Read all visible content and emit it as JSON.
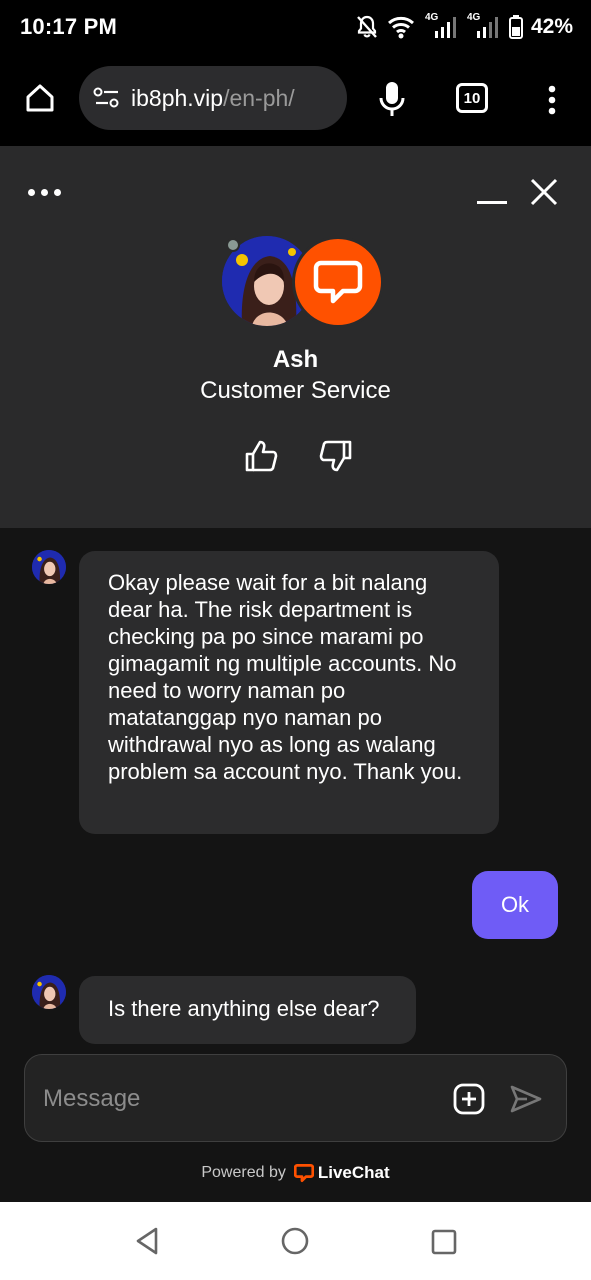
{
  "status_bar": {
    "time": "10:17 PM",
    "net_label_1": "4G",
    "net_label_2": "4G",
    "battery": "42%"
  },
  "browser": {
    "url_host": "ib8ph.vip",
    "url_path": "/en-ph/",
    "tab_count": "10"
  },
  "chat_header": {
    "agent_name": "Ash",
    "agent_role": "Customer Service",
    "brand_color": "#ff5100"
  },
  "messages": [
    {
      "direction": "in",
      "text": "Okay please wait for a bit nalang dear ha. The risk department is checking pa po since marami po gimagamit ng multiple accounts. No need to worry naman po matatanggap nyo naman po withdrawal nyo as long as walang problem sa account nyo. Thank you."
    },
    {
      "direction": "out",
      "text": "Ok"
    },
    {
      "direction": "in",
      "text": "Is there anything else dear?"
    }
  ],
  "composer": {
    "placeholder": "Message"
  },
  "footer": {
    "powered_by": "Powered by",
    "brand": "LiveChat"
  },
  "colors": {
    "outgoing_bubble": "#6f5cf6",
    "incoming_bubble": "#2c2c2d",
    "header_bg": "#2a2a2b",
    "chat_bg": "#141414"
  }
}
